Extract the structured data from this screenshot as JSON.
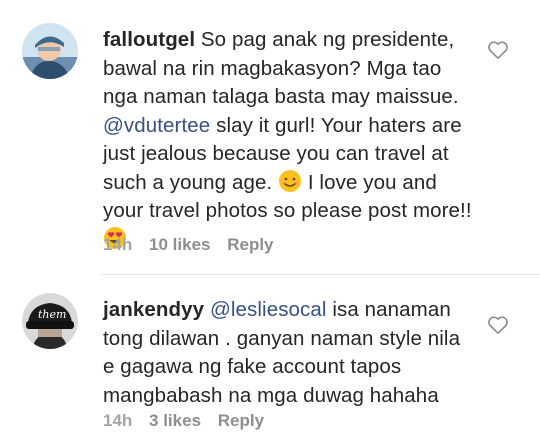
{
  "comments": [
    {
      "username": "falloutgel",
      "text_parts": [
        "So pag anak ng presidente, bawal na rin magbakasyon? Mga tao nga naman talaga basta may maissue. ",
        "@vdutertee",
        " slay it gurl! Your haters are just jealous because you can travel at such a young age. ",
        " I love you and your travel photos so please post more!! "
      ],
      "emojis": [
        "smiling-face-emoji",
        "heart-eyes-emoji"
      ],
      "time": "14h",
      "likes": "10 likes",
      "reply": "Reply"
    },
    {
      "username": "jankendyy",
      "text_parts": [
        "@lesliesocal",
        " isa nanaman tong dilawan . ganyan naman style nila e gagawa ng fake account tapos mangbabash na mga duwag hahaha"
      ],
      "avatar_text": "them",
      "time": "14h",
      "likes": "3 likes",
      "reply": "Reply"
    }
  ],
  "colors": {
    "text": "#262626",
    "mention": "#385185",
    "meta": "#8e8e8e",
    "divider": "#e6e6e6"
  }
}
